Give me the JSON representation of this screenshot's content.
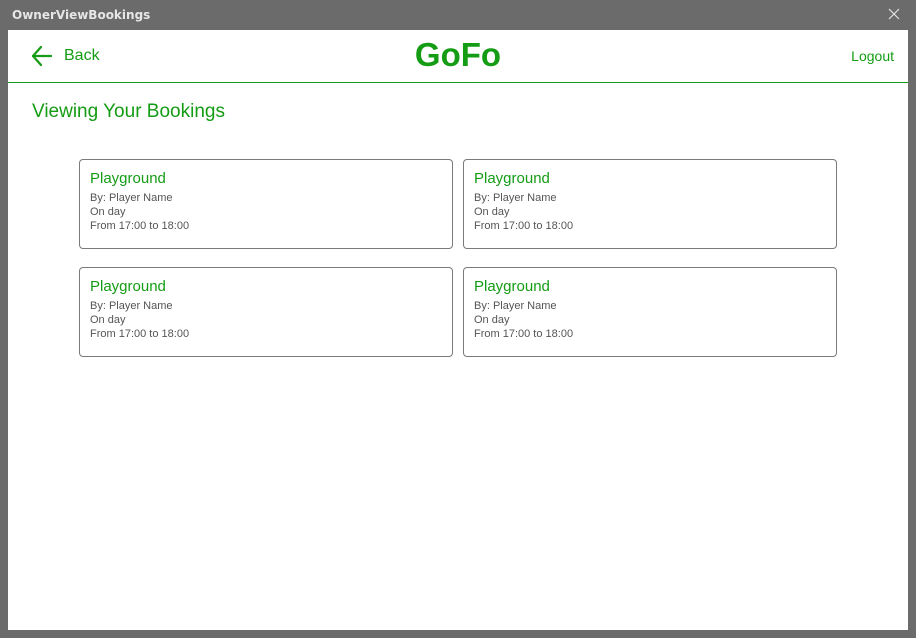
{
  "window": {
    "title": "OwnerViewBookings"
  },
  "header": {
    "back_label": "Back",
    "brand": "GoFo",
    "logout_label": "Logout"
  },
  "main": {
    "title": "Viewing Your Bookings",
    "bookings": [
      {
        "title": "Playground",
        "by": "By: Player Name",
        "day": "On day",
        "time": "From 17:00 to 18:00"
      },
      {
        "title": "Playground",
        "by": "By: Player Name",
        "day": "On day",
        "time": "From 17:00 to 18:00"
      },
      {
        "title": "Playground",
        "by": "By: Player Name",
        "day": "On day",
        "time": "From 17:00 to 18:00"
      },
      {
        "title": "Playground",
        "by": "By: Player Name",
        "day": "On day",
        "time": "From 17:00 to 18:00"
      }
    ]
  },
  "colors": {
    "accent": "#149c14",
    "frame": "#6b6b6b",
    "card_border": "#7a7a7a"
  }
}
